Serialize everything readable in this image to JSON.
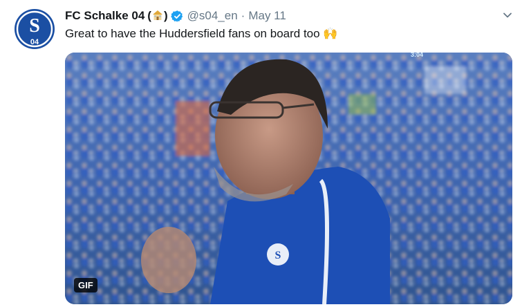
{
  "tweet": {
    "display_name": "FC Schalke 04",
    "name_emoji_open": "(",
    "name_emoji_close": ")",
    "emoji_icon": "stadium-house-icon",
    "verified_icon": "verified-badge-icon",
    "handle": "@s04_en",
    "separator": "·",
    "date": "May 11",
    "text": "Great to have the Huddersfield fans on board too 🙌",
    "more_icon": "chevron-down-icon"
  },
  "avatar": {
    "club_letter": "S",
    "club_number": "04",
    "colors": {
      "blue": "#1b4fa3",
      "white": "#ffffff"
    }
  },
  "media": {
    "type": "gif",
    "badge_label": "GIF",
    "scoreboard_text": "3:04"
  },
  "colors": {
    "text_primary": "#14171a",
    "text_secondary": "#657786",
    "verified_blue": "#1da1f2",
    "jersey_blue": "#1d4fb5"
  }
}
